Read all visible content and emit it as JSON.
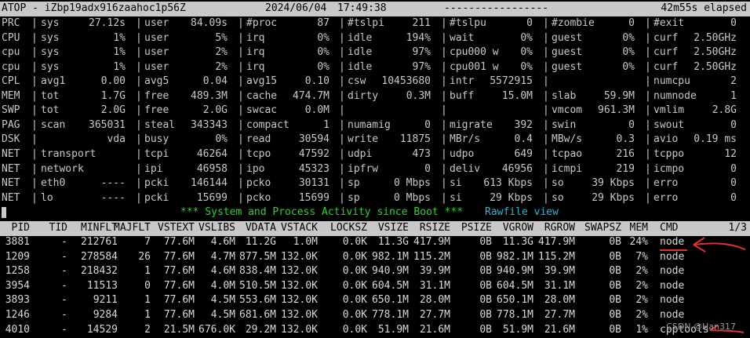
{
  "title_bar": {
    "host": "ATOP - iZbp19adx916zaahoc1p56Z",
    "date": "2024/06/04",
    "time": "17:49:38",
    "dashes": "-----------------",
    "elapsed": "42m55s elapsed"
  },
  "system_rows": [
    [
      "PRC",
      "sys",
      "27.12s",
      "user",
      "84.09s",
      "#proc",
      "87",
      "#tslpi",
      "211",
      "#tslpu",
      "0",
      "#zombie",
      "0",
      "#exit",
      "0"
    ],
    [
      "CPU",
      "sys",
      "1%",
      "user",
      "5%",
      "irq",
      "0%",
      "idle",
      "194%",
      "wait",
      "0%",
      "guest",
      "0%",
      "curf",
      "2.50GHz"
    ],
    [
      "cpu",
      "sys",
      "1%",
      "user",
      "2%",
      "irq",
      "0%",
      "idle",
      "97%",
      "cpu000 w",
      "0%",
      "guest",
      "0%",
      "curf",
      "2.50GHz"
    ],
    [
      "cpu",
      "sys",
      "1%",
      "user",
      "2%",
      "irq",
      "0%",
      "idle",
      "97%",
      "cpu001 w",
      "0%",
      "guest",
      "0%",
      "curf",
      "2.50GHz"
    ],
    [
      "CPL",
      "avg1",
      "0.00",
      "avg5",
      "0.04",
      "avg15",
      "0.10",
      "csw",
      "10453680",
      "intr",
      "5572915",
      "",
      "",
      "numcpu",
      "2"
    ],
    [
      "MEM",
      "tot",
      "1.7G",
      "free",
      "489.3M",
      "cache",
      "474.7M",
      "dirty",
      "0.3M",
      "buff",
      "15.0M",
      "slab",
      "59.9M",
      "numnode",
      "1"
    ],
    [
      "SWP",
      "tot",
      "2.0G",
      "free",
      "2.0G",
      "swcac",
      "0.0M",
      "",
      "",
      "",
      "",
      "vmcom",
      "961.3M",
      "vmlim",
      "2.8G"
    ],
    [
      "PAG",
      "scan",
      "365031",
      "steal",
      "343343",
      "compact",
      "1",
      "numamig",
      "0",
      "migrate",
      "392",
      "swin",
      "0",
      "swout",
      "0"
    ],
    [
      "DSK",
      "",
      "vda",
      "busy",
      "0%",
      "read",
      "30594",
      "write",
      "11875",
      "MBr/s",
      "0.4",
      "MBw/s",
      "0.3",
      "avio",
      "0.19 ms"
    ],
    [
      "NET",
      "transport",
      "",
      "tcpi",
      "46264",
      "tcpo",
      "47592",
      "udpi",
      "473",
      "udpo",
      "649",
      "tcpao",
      "216",
      "tcppo",
      "12"
    ],
    [
      "NET",
      "network",
      "",
      "ipi",
      "46958",
      "ipo",
      "45323",
      "ipfrw",
      "0",
      "deliv",
      "46956",
      "icmpi",
      "219",
      "icmpo",
      "0"
    ],
    [
      "NET",
      "eth0",
      "----",
      "pcki",
      "146144",
      "pcko",
      "30131",
      "sp",
      "0 Mbps",
      "si",
      "613 Kbps",
      "so",
      "39 Kbps",
      "erro",
      "0"
    ],
    [
      "NET",
      "lo",
      "----",
      "pcki",
      "15699",
      "pcko",
      "15699",
      "sp",
      "0 Mbps",
      "si",
      "29 Kbps",
      "so",
      "29 Kbps",
      "erro",
      "0"
    ]
  ],
  "banner": "*** System and Process Activity since Boot ***",
  "rawfile": "Rawfile view",
  "proc_headers": [
    "PID",
    "TID",
    "MINFLT",
    "MAJFLT",
    "VSTEXT",
    "VSLIBS",
    "VDATA",
    "VSTACK",
    "LOCKSZ",
    "VSIZE",
    "RSIZE",
    "PSIZE",
    "VGROW",
    "RGROW",
    "SWAPSZ",
    "MEM",
    "CMD",
    "1/3"
  ],
  "processes": [
    [
      "3881",
      "-",
      "212761",
      "7",
      "77.6M",
      "4.6M",
      "11.2G",
      "1.0M",
      "0.0K",
      "11.3G",
      "417.9M",
      "0B",
      "11.3G",
      "417.9M",
      "0B",
      "24%",
      "node"
    ],
    [
      "1209",
      "-",
      "278584",
      "26",
      "77.6M",
      "4.7M",
      "877.5M",
      "132.0K",
      "0.0K",
      "982.1M",
      "115.2M",
      "0B",
      "982.1M",
      "115.2M",
      "0B",
      "7%",
      "node"
    ],
    [
      "1258",
      "-",
      "218432",
      "1",
      "77.6M",
      "4.6M",
      "838.4M",
      "132.0K",
      "0.0K",
      "940.9M",
      "39.9M",
      "0B",
      "940.9M",
      "39.9M",
      "0B",
      "2%",
      "node"
    ],
    [
      "3954",
      "-",
      "11513",
      "0",
      "77.6M",
      "4.0M",
      "510.5M",
      "132.0K",
      "0.0K",
      "604.5M",
      "31.1M",
      "0B",
      "604.5M",
      "31.1M",
      "0B",
      "2%",
      "node"
    ],
    [
      "3893",
      "-",
      "9211",
      "1",
      "77.6M",
      "4.5M",
      "553.6M",
      "132.0K",
      "0.0K",
      "650.1M",
      "28.0M",
      "0B",
      "650.1M",
      "28.0M",
      "0B",
      "2%",
      "node"
    ],
    [
      "1246",
      "-",
      "9284",
      "1",
      "77.6M",
      "4.5M",
      "681.6M",
      "132.0K",
      "0.0K",
      "778.1M",
      "27.7M",
      "0B",
      "778.1M",
      "27.7M",
      "0B",
      "2%",
      "node"
    ],
    [
      "4010",
      "-",
      "14529",
      "2",
      "21.5M",
      "676.0K",
      "29.2M",
      "132.0K",
      "0.0K",
      "51.9M",
      "21.6M",
      "0B",
      "51.9M",
      "21.6M",
      "0B",
      "1%",
      "cpptools"
    ]
  ],
  "watermark": "CSDN @Han317",
  "colors": {
    "background": "#000000",
    "text": "#cccccc",
    "header_bar": "#c8c8c8",
    "banner": "#2bd62b",
    "rawfile": "#2fb5d6",
    "annotation": "#e03030"
  }
}
